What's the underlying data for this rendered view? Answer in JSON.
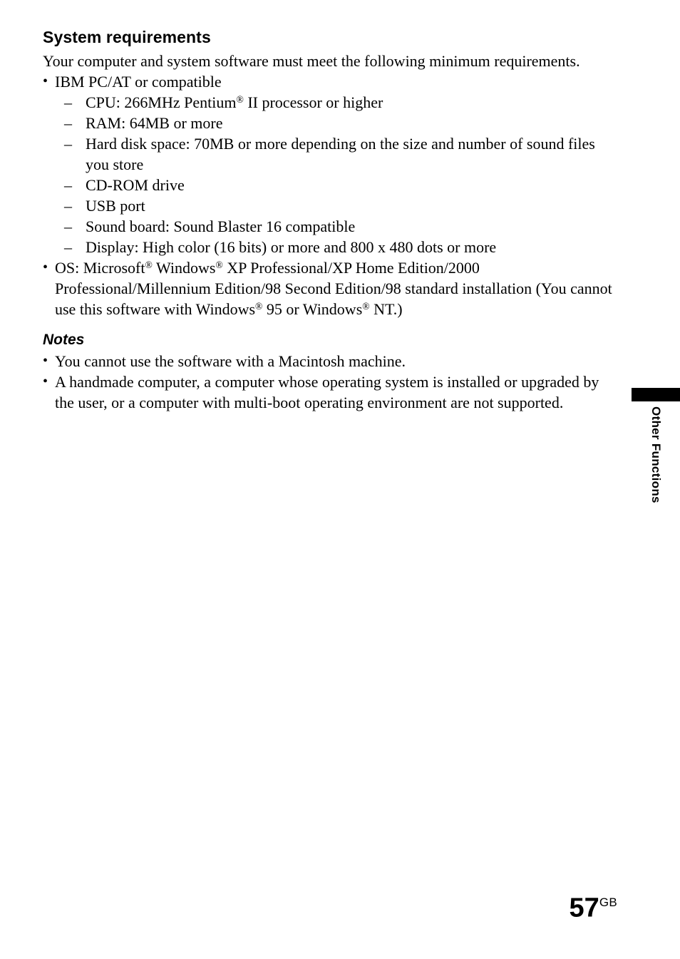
{
  "section": {
    "title": "System requirements",
    "intro": "Your computer and system software must meet the following minimum requirements."
  },
  "requirements": {
    "hardware_bullet": "IBM PC/AT or compatible",
    "sub_items": [
      {
        "pre": "CPU: 266MHz Pentium",
        "reg": "®",
        "post": " II processor or higher"
      },
      {
        "pre": "RAM: 64MB or more",
        "reg": "",
        "post": ""
      },
      {
        "pre": "Hard disk space: 70MB or more depending on the size and number of sound files you store",
        "reg": "",
        "post": ""
      },
      {
        "pre": "CD-ROM drive",
        "reg": "",
        "post": ""
      },
      {
        "pre": "USB port",
        "reg": "",
        "post": ""
      },
      {
        "pre": "Sound board: Sound Blaster 16 compatible",
        "reg": "",
        "post": ""
      },
      {
        "pre": "Display: High color (16 bits) or more and 800 x 480 dots or more",
        "reg": "",
        "post": ""
      }
    ],
    "os_bullet": {
      "part1": "OS: Microsoft",
      "reg1": "®",
      "part2": " Windows",
      "reg2": "®",
      "part3": " XP Professional/XP Home Edition/2000 Professional/Millennium Edition/98 Second Edition/98 standard installation  (You cannot use this software with Windows",
      "reg3": "®",
      "part4": " 95 or Windows",
      "reg4": "®",
      "part5": " NT.)"
    }
  },
  "notes": {
    "title": "Notes",
    "items": [
      "You cannot use the software with a Macintosh machine.",
      "A handmade computer, a computer whose operating system is installed or upgraded by the user, or a computer with multi-boot operating environment are not supported."
    ]
  },
  "side_tab": {
    "label": "Other Functions"
  },
  "footer": {
    "page_number": "57",
    "page_suffix": "GB"
  },
  "markers": {
    "bullet": "•",
    "dash": "–"
  },
  "colors": {
    "text": "#000000",
    "background": "#ffffff",
    "tab_bar": "#000000"
  }
}
